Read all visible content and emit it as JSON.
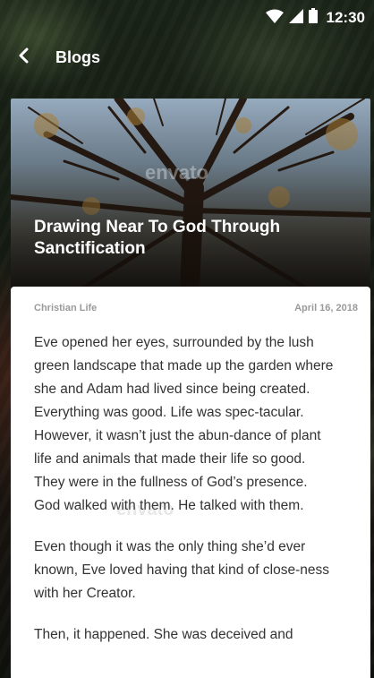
{
  "status_bar": {
    "time": "12:30"
  },
  "app_bar": {
    "title": "Blogs"
  },
  "post": {
    "title": "Drawing Near To God Through Sanctification",
    "category": "Christian Life",
    "date": "April 16, 2018",
    "watermark": "envato",
    "paragraphs": [
      "Eve opened her eyes, surrounded by the lush green landscape that made up the garden where she and Adam had lived since being created. Everything was good. Life was spec-tacular. However, it wasn’t just the abun-dance of plant life and animals that made their life so good. They were in the fullness of God’s presence. God walked with them. He talked with them.",
      "Even though it was the only thing she’d ever known, Eve loved having that kind of close-ness with her Creator.",
      "Then, it happened. She was deceived and"
    ]
  },
  "colors": {
    "card_background": "#ffffff",
    "meta_text": "#9a9a9a",
    "body_text": "#333333"
  }
}
